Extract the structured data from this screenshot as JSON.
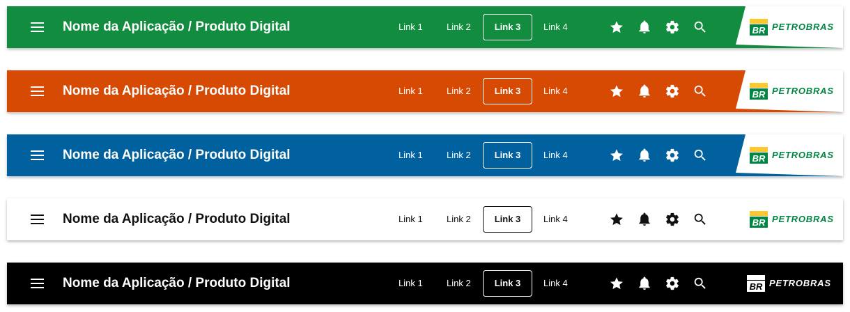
{
  "bars": [
    {
      "bg": "#128C3E",
      "fg": "#FFFFFF",
      "card": true,
      "logo_dark": false
    },
    {
      "bg": "#D74A04",
      "fg": "#FFFFFF",
      "card": true,
      "logo_dark": false
    },
    {
      "bg": "#00619E",
      "fg": "#FFFFFF",
      "card": true,
      "logo_dark": false
    },
    {
      "bg": "#FFFFFF",
      "fg": "#111111",
      "card": false,
      "logo_dark": false
    },
    {
      "bg": "#000000",
      "fg": "#FFFFFF",
      "card": false,
      "logo_dark": true
    }
  ],
  "title": "Nome da Aplicação / Produto Digital",
  "links": [
    "Link 1",
    "Link 2",
    "Link 3",
    "Link 4"
  ],
  "active_link_index": 2,
  "icons": [
    "menu-icon",
    "star-icon",
    "bell-icon",
    "gear-icon",
    "search-icon"
  ],
  "logo": {
    "mark": "BR",
    "text": "PETROBRAS",
    "green": "#008542",
    "yellow": "#FDC82F"
  }
}
